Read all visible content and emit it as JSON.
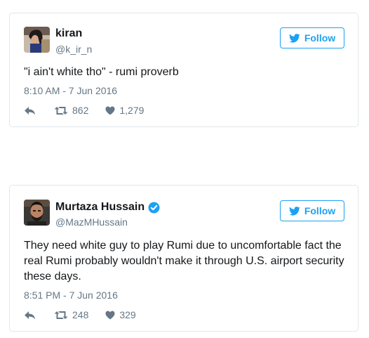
{
  "colors": {
    "accent": "#1da1f2",
    "text": "#14171a",
    "muted": "#657786",
    "border": "#e1e8ed"
  },
  "tweets": [
    {
      "avatar_icon": "user-avatar-photo",
      "name": "kiran",
      "verified": false,
      "handle": "@k_ir_n",
      "follow_label": "Follow",
      "text": "\"i ain't white tho\" - rumi proverb",
      "timestamp": "8:10 AM - 7 Jun 2016",
      "retweets": "862",
      "likes": "1,279"
    },
    {
      "avatar_icon": "user-avatar-photo",
      "name": "Murtaza Hussain",
      "verified": true,
      "handle": "@MazMHussain",
      "follow_label": "Follow",
      "text": "They need white guy to play Rumi due to uncomfortable fact the real Rumi probably wouldn't make it through U.S. airport security these days.",
      "timestamp": "8:51 PM - 7 Jun 2016",
      "retweets": "248",
      "likes": "329"
    }
  ]
}
